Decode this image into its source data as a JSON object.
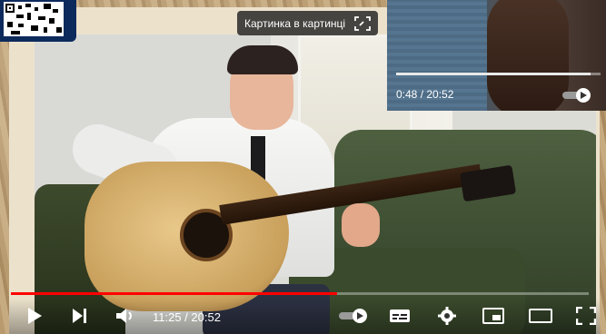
{
  "pip_tooltip": {
    "label": "Картинка в картинці"
  },
  "main_player": {
    "time_display": "11:25 / 20:52",
    "progress_fraction": 0.564
  },
  "pip_player": {
    "time_display": "0:48 / 20:52",
    "progress_fraction": 0.95
  },
  "colors": {
    "progress": "#ff0000",
    "qr_frame": "#0d2a5c"
  },
  "icons": [
    "play-icon",
    "next-icon",
    "volume-icon",
    "autoplay-toggle-icon",
    "subtitles-icon",
    "settings-icon",
    "miniplayer-icon",
    "theater-icon",
    "fullscreen-icon",
    "pip-exit-icon"
  ]
}
